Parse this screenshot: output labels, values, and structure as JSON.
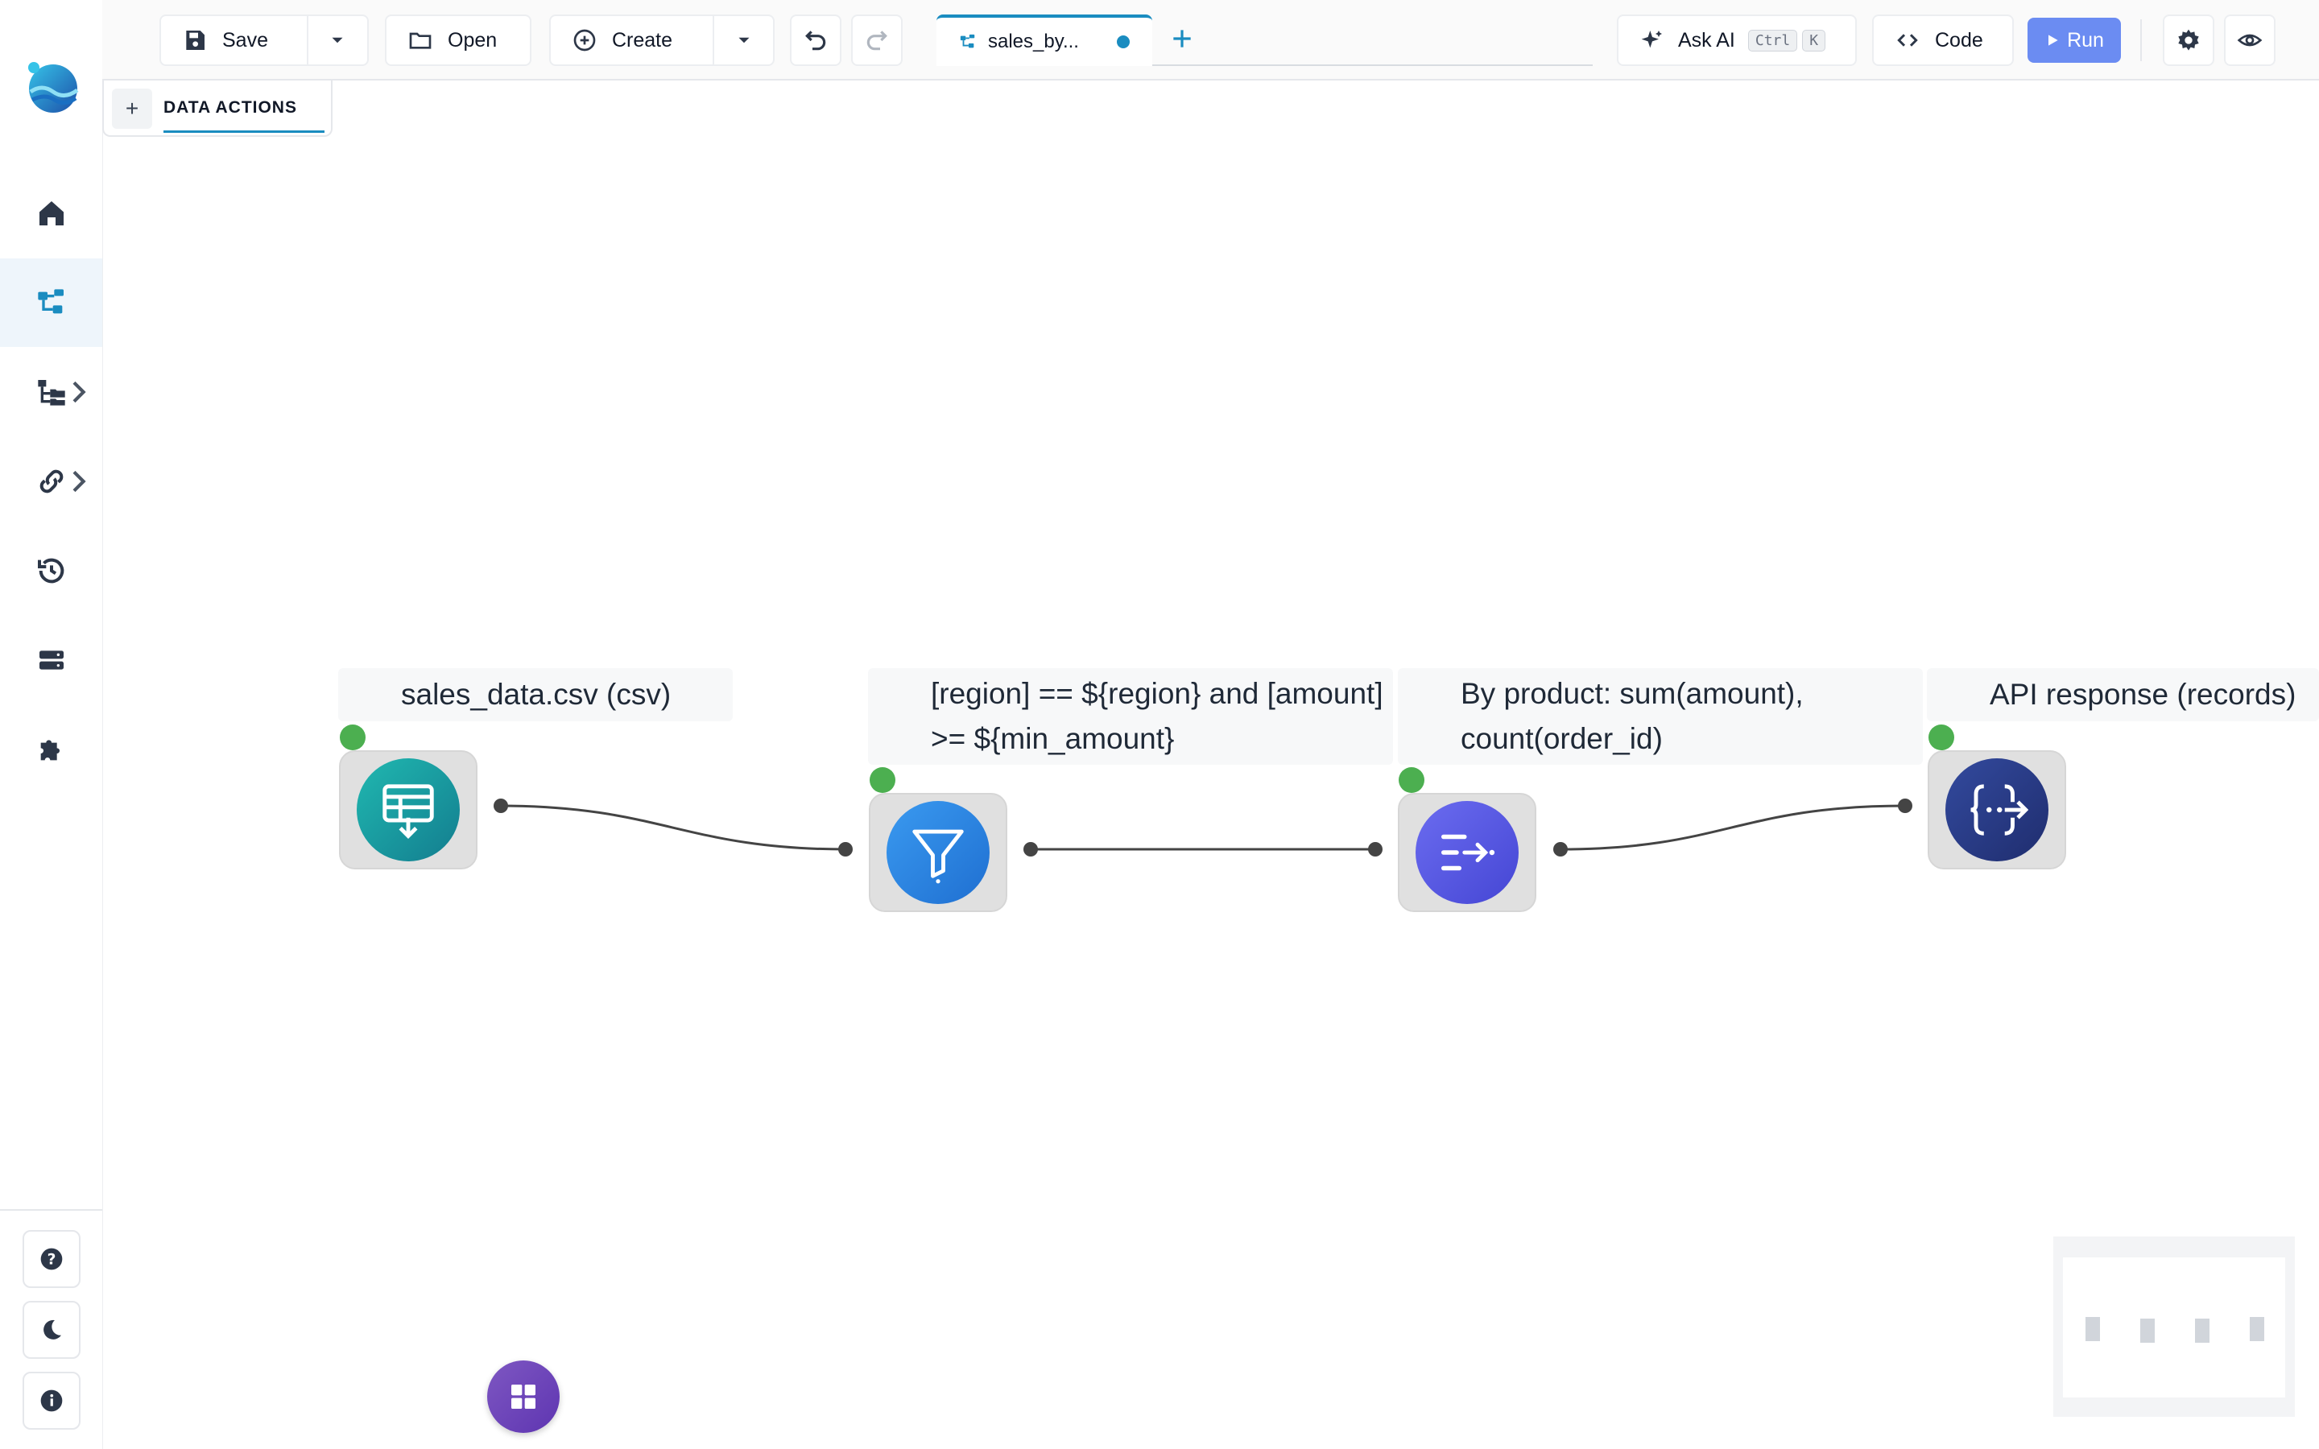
{
  "toolbar": {
    "save_label": "Save",
    "open_label": "Open",
    "create_label": "Create",
    "ask_ai_label": "Ask AI",
    "ask_ai_shortcut_ctrl": "Ctrl",
    "ask_ai_shortcut_key": "K",
    "code_label": "Code",
    "run_label": "Run"
  },
  "tab": {
    "title": "sales_by...",
    "unsaved": true
  },
  "data_actions": {
    "label": "DATA ACTIONS",
    "add": "+"
  },
  "nodes": [
    {
      "label": "sales_data.csv (csv)",
      "icon": "table-download-icon",
      "color": "#1aa3a8",
      "status": "ok"
    },
    {
      "label": "[region] == ${region} and [amount] >= ${min_amount}",
      "icon": "filter-icon",
      "color": "#2f86e0",
      "status": "ok"
    },
    {
      "label": "By product: sum(amount), count(order_id)",
      "icon": "aggregate-icon",
      "color": "#5b5fe6",
      "status": "ok"
    },
    {
      "label": "API response (records)",
      "icon": "json-output-icon",
      "color": "#283a8c",
      "status": "ok"
    }
  ],
  "sidebar": {
    "items": [
      "home",
      "flows",
      "file-tree",
      "connections",
      "history",
      "storage",
      "plugins"
    ],
    "active": "flows"
  },
  "colors": {
    "accent": "#1a8cc0",
    "run": "#6b8cf2",
    "status_ok": "#4caf50"
  }
}
